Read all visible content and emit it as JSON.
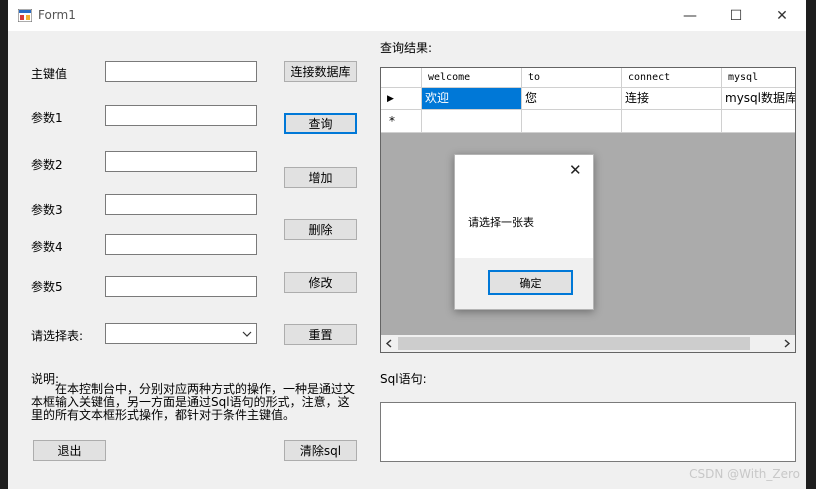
{
  "window": {
    "title": "Form1",
    "minimize": "—",
    "maximize": "☐",
    "close": "✕"
  },
  "form": {
    "key_label": "主键值",
    "param1_label": "参数1",
    "param2_label": "参数2",
    "param3_label": "参数3",
    "param4_label": "参数4",
    "param5_label": "参数5",
    "table_select_label": "请选择表:",
    "table_select_value": "",
    "description_title": "说明:",
    "description_text": "在本控制台中，分别对应两种方式的操作，一种是通过文本框输入关键值，另一方面是通过Sql语句的形式，注意，这里的所有文本框形式操作，都针对于条件主键值。"
  },
  "buttons": {
    "connect": "连接数据库",
    "query": "查询",
    "add": "增加",
    "delete": "删除",
    "modify": "修改",
    "reset": "重置",
    "exit": "退出",
    "clear_sql": "清除sql"
  },
  "results": {
    "label": "查询结果:",
    "columns": [
      "welcome",
      "to",
      "connect",
      "mysql"
    ],
    "rows": [
      [
        "欢迎",
        "您",
        "连接",
        "mysql数据库"
      ]
    ],
    "new_row_marker": "*",
    "current_row_marker": "▶"
  },
  "sql": {
    "label": "Sql语句:",
    "value": ""
  },
  "dialog": {
    "message": "请选择一张表",
    "ok_button": "确定",
    "close": "✕"
  },
  "watermark": "CSDN @With_Zero",
  "colors": {
    "selection": "#0078d7",
    "grid_background": "#ababab",
    "form_background": "#f0f0f0"
  }
}
